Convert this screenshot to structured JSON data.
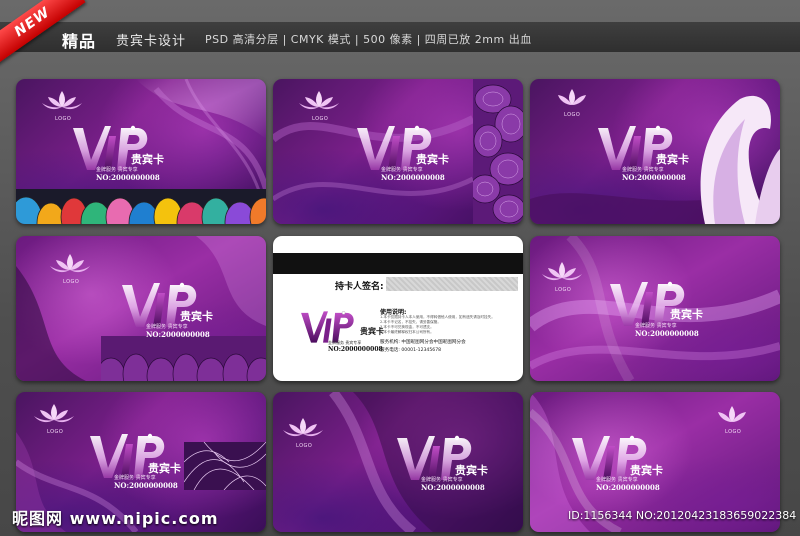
{
  "header": {
    "badge": "NEW",
    "title_strong": "精品",
    "title_sub": "贵宾卡设计",
    "specs": "PSD 高清分层 | CMYK 模式 | 500 像素 | 四周已放 2mm 出血"
  },
  "card": {
    "vip": "VIP",
    "cn_label": "贵宾卡",
    "subline": "金牌服务  贵宾专享",
    "number": "NO:2000000008",
    "logo_text": "LOGO"
  },
  "back": {
    "signature_label": "持卡人签名:",
    "usage_title": "使用说明:",
    "usage_lines": [
      "1.本卡仅限持卡人本人使用，不得转借他人使用，如有遗失请及时挂失。",
      "2.本卡不记名，不挂失，请妥善保管。",
      "3.本卡不可兑换现金，不可透支。",
      "4.本卡最终解释权归本公司所有。"
    ],
    "service_org": "服务机构: 中国昵图网分会中国昵图网分会",
    "service_tel": "服务电话: 00001-12345678"
  },
  "footer": {
    "site": "昵图网 www.nipic.com",
    "id": "ID:1156344 NO:20120423183659022384"
  },
  "colors": {
    "card_purple": "#7a1f8a",
    "card_dark": "#3a0e58",
    "ribbon_red": "#d81010",
    "background": "#555555"
  }
}
